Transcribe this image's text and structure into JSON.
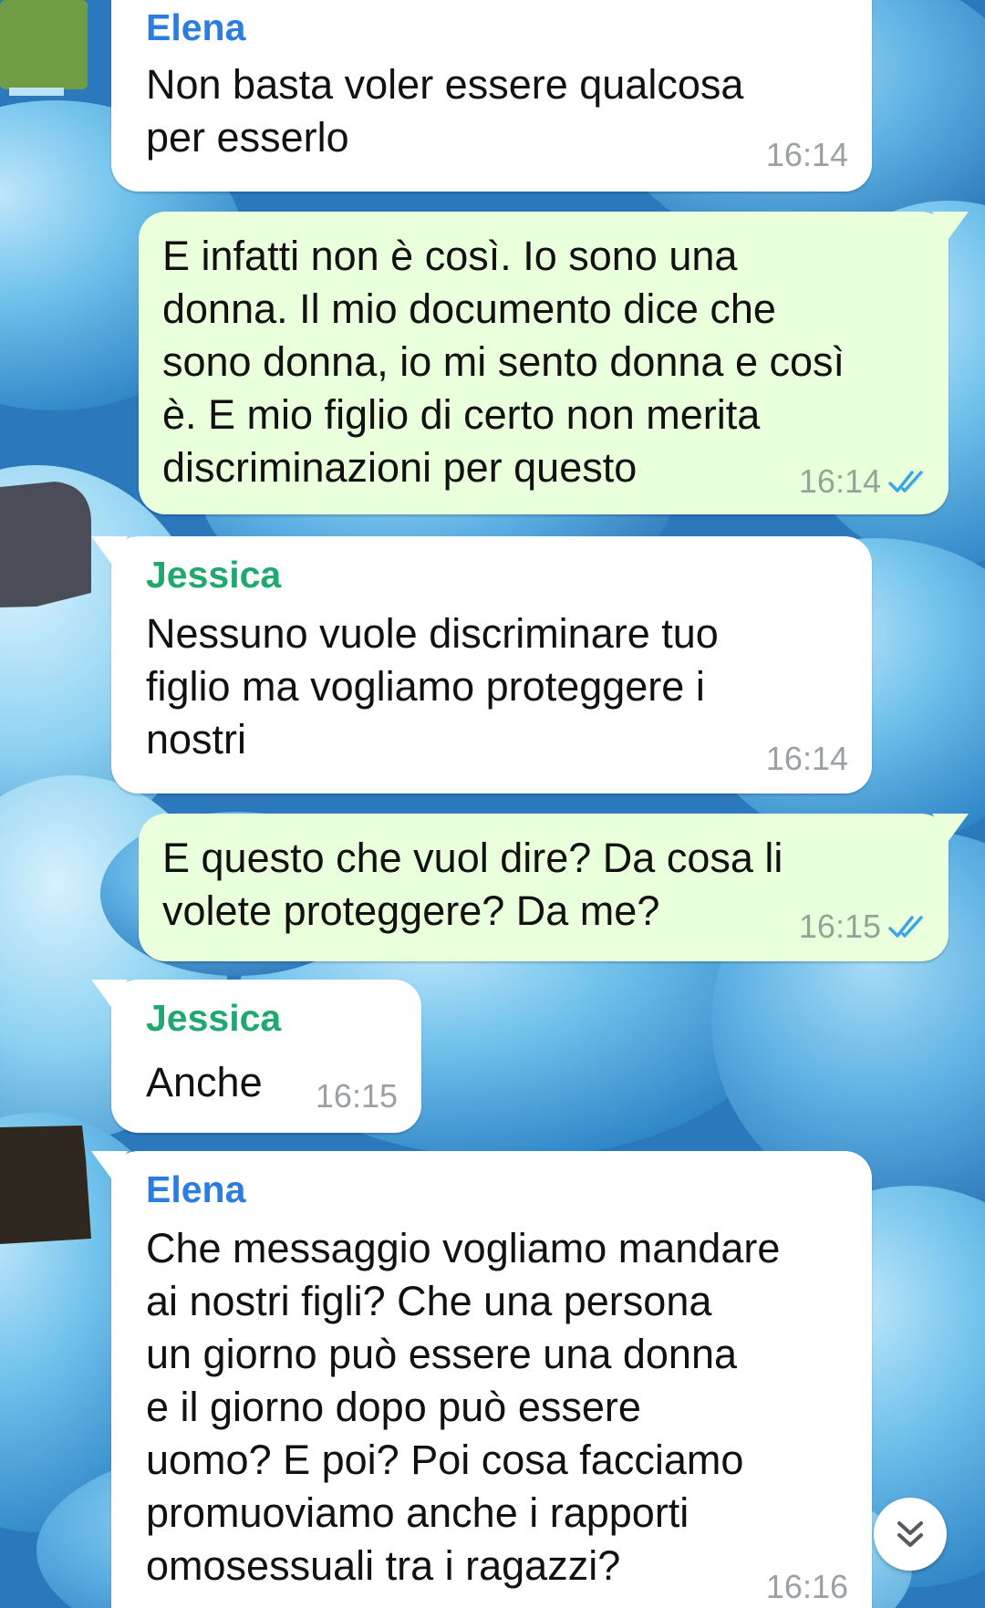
{
  "colors": {
    "incoming_bubble": "#ffffff",
    "outgoing_bubble": "#eaffdb",
    "sender_elena": "#2a7de1",
    "sender_jessica": "#1fa870",
    "read_ticks": "#39a6e8",
    "timestamp": "#9aa0a4"
  },
  "messages": [
    {
      "direction": "in",
      "sender": "Elena",
      "text": "Non basta voler essere qualcosa\nper esserlo",
      "time": "16:14"
    },
    {
      "direction": "out",
      "text": "E infatti non è così. Io sono una\ndonna. Il mio documento dice che\nsono donna, io mi sento donna e così\nè. E mio figlio di certo non merita\ndiscriminazioni per questo",
      "time": "16:14",
      "status": "read"
    },
    {
      "direction": "in",
      "sender": "Jessica",
      "text": "Nessuno vuole discriminare tuo\nfiglio ma vogliamo proteggere i\nnostri",
      "time": "16:14"
    },
    {
      "direction": "out",
      "text": "E questo che vuol dire? Da cosa li\nvolete proteggere? Da me?",
      "time": "16:15",
      "status": "read"
    },
    {
      "direction": "in",
      "sender": "Jessica",
      "text": "Anche",
      "time": "16:15"
    },
    {
      "direction": "in",
      "sender": "Elena",
      "text": "Che messaggio vogliamo mandare\nai nostri figli? Che una persona\nun giorno può essere una donna\ne il giorno dopo può essere\nuomo? E poi? Poi cosa facciamo\npromuoviamo anche i rapporti\nomosessuali tra i ragazzi?",
      "time": "16:16"
    }
  ],
  "scroll_button": {
    "icon": "double-chevron-down-icon"
  }
}
